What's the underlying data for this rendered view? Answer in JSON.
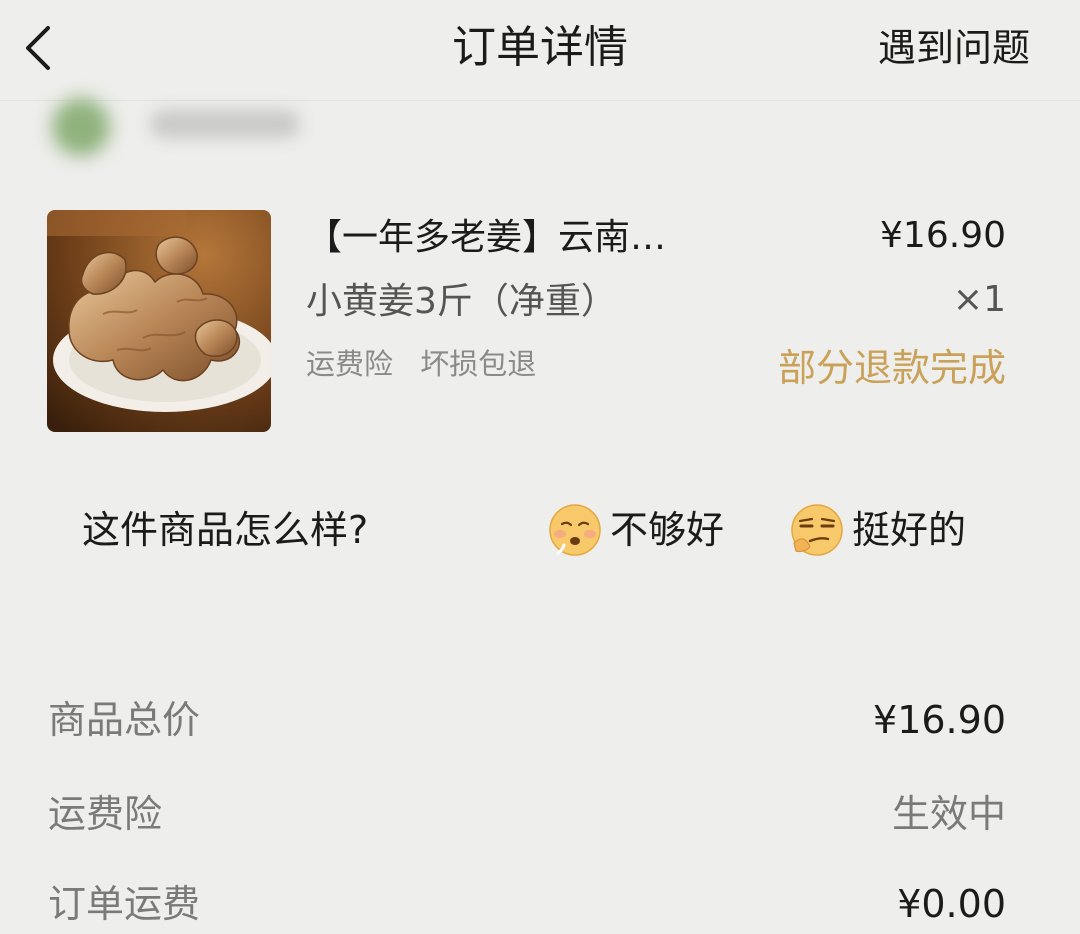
{
  "header": {
    "title": "订单详情",
    "help_label": "遇到问题",
    "back_icon": "chevron-left-icon"
  },
  "product": {
    "title": "【一年多老姜】云南…",
    "sku": "小黄姜3斤（净重）",
    "tags": [
      "运费险",
      "坏损包退"
    ],
    "price": "¥16.90",
    "quantity": "×1",
    "status": "部分退款完成",
    "image": "ginger-photo"
  },
  "rating": {
    "question": "这件商品怎么样?",
    "options": [
      {
        "label": "不够好",
        "icon": "disappointed-face-icon"
      },
      {
        "label": "挺好的",
        "icon": "smug-face-icon"
      }
    ]
  },
  "summary": [
    {
      "label": "商品总价",
      "value": "¥16.90"
    },
    {
      "label": "运费险",
      "value": "生效中"
    },
    {
      "label": "订单运费",
      "value": "¥0.00"
    }
  ],
  "colors": {
    "background": "#eeeeec",
    "status_accent": "#caa158",
    "text_primary": "#1b1b1b",
    "text_secondary": "#7a7a78"
  }
}
